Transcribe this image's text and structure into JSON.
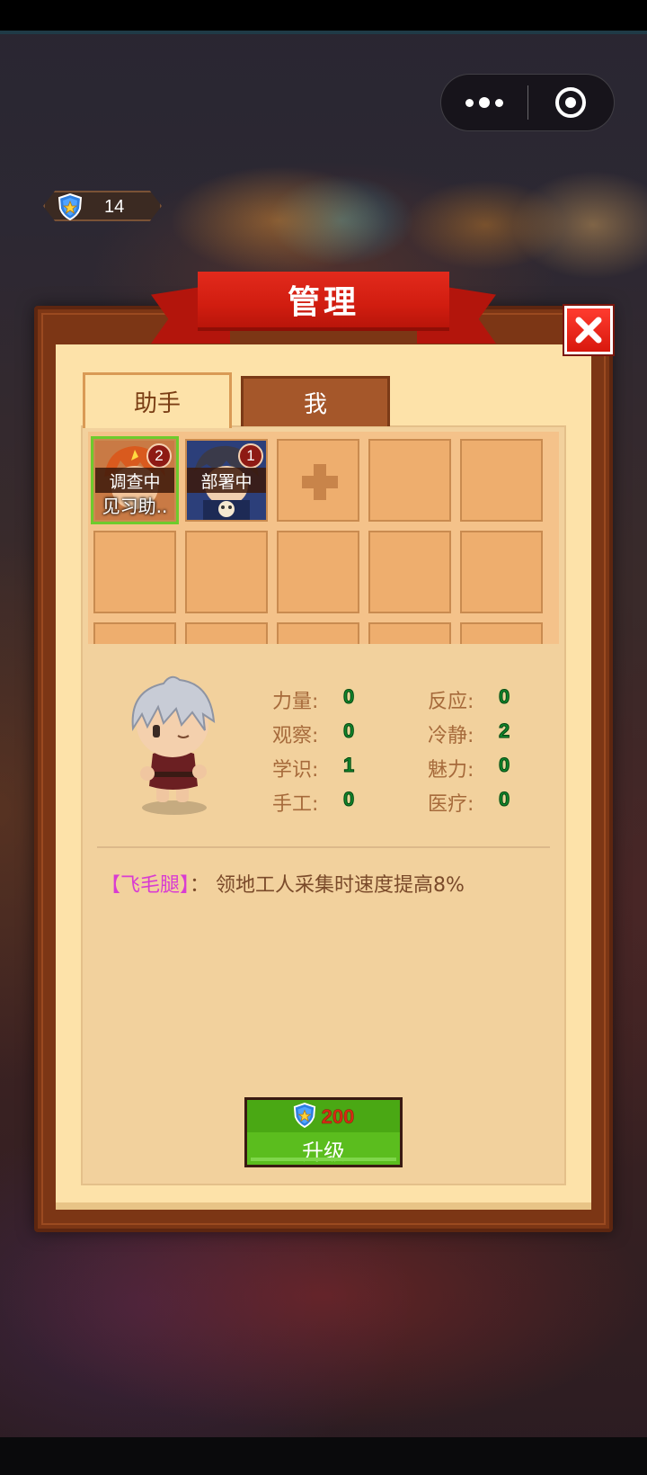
{
  "hud": {
    "shield_count": "14"
  },
  "dialog": {
    "title": "管理",
    "tabs": [
      {
        "label": "助手",
        "active": true
      },
      {
        "label": "我",
        "active": false
      }
    ],
    "helpers": [
      {
        "status": "调查中",
        "name": "见习助..",
        "badge": "2",
        "selected": true
      },
      {
        "status": "部署中",
        "name": "",
        "badge": "1",
        "selected": false
      }
    ],
    "add_slot_icon": "plus-icon",
    "stats": [
      {
        "label": "力量:",
        "value": "0"
      },
      {
        "label": "反应:",
        "value": "0"
      },
      {
        "label": "观察:",
        "value": "0"
      },
      {
        "label": "冷静:",
        "value": "2"
      },
      {
        "label": "学识:",
        "value": "1"
      },
      {
        "label": "魅力:",
        "value": "0"
      },
      {
        "label": "手工:",
        "value": "0"
      },
      {
        "label": "医疗:",
        "value": "0"
      }
    ],
    "skill": {
      "name": "【飞毛腿】",
      "description": "：  领地工人采集时速度提高8%"
    },
    "upgrade": {
      "cost": "200",
      "label": "升级"
    }
  },
  "colors": {
    "ribbon_red": "#d11d10",
    "frame_brown": "#7c3615",
    "paper": "#fde2a9",
    "stat_green": "#0f8a2a",
    "skill_magenta": "#d93cd2",
    "button_green": "#5bbd1e"
  }
}
